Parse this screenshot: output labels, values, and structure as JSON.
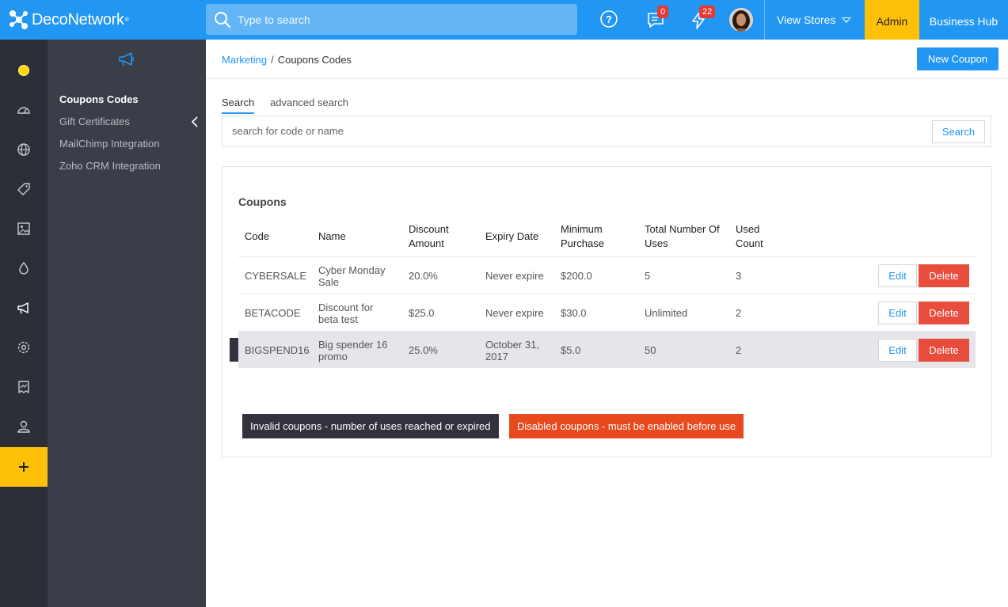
{
  "topbar": {
    "brand": "DecoNetwork",
    "brand_mark": "®",
    "search_placeholder": "Type to search",
    "messages_count": "0",
    "notifications_count": "22",
    "view_stores": "View Stores",
    "admin": "Admin",
    "business_hub": "Business Hub"
  },
  "rail": {
    "icons": [
      "status-dot-icon",
      "dashboard-icon",
      "globe-icon",
      "tag-icon",
      "image-icon",
      "drop-icon",
      "megaphone-icon",
      "settings-icon",
      "report-icon",
      "user-icon"
    ],
    "plus": "+"
  },
  "subnav": {
    "items": [
      {
        "label": "Coupons Codes",
        "active": true
      },
      {
        "label": "Gift Certificates"
      },
      {
        "label": "MailChimp Integration"
      },
      {
        "label": "Zoho CRM Integration"
      }
    ]
  },
  "breadcrumb": {
    "parent": "Marketing",
    "separator": "/",
    "current": "Coupons Codes"
  },
  "actions": {
    "new_coupon": "New Coupon"
  },
  "tabs": [
    {
      "label": "Search"
    },
    {
      "label": "advanced search"
    }
  ],
  "search": {
    "placeholder": "search for code or name",
    "button": "Search"
  },
  "coupons": {
    "title": "Coupons",
    "headers": {
      "code": "Code",
      "name": "Name",
      "discount": [
        "Discount",
        "Amount"
      ],
      "expiry": "Expiry Date",
      "min_purchase": [
        "Minimum",
        "Purchase"
      ],
      "total_uses": [
        "Total Number Of",
        "Uses"
      ],
      "used": [
        "Used",
        "Count"
      ]
    },
    "rows": [
      {
        "code": "CYBERSALE",
        "name": [
          "Cyber Monday",
          "Sale"
        ],
        "discount": "20.0%",
        "expiry": [
          "Never expire"
        ],
        "min": "$200.0",
        "total": "5",
        "used": "3",
        "edit": "Edit",
        "delete": "Delete"
      },
      {
        "code": "BETACODE",
        "name": [
          "Discount for",
          "beta test"
        ],
        "discount": "$25.0",
        "expiry": [
          "Never expire"
        ],
        "min": "$30.0",
        "total": "Unlimited",
        "used": "2",
        "edit": "Edit",
        "delete": "Delete"
      },
      {
        "code": "BIGSPEND16",
        "name": [
          "Big spender 16",
          "promo"
        ],
        "discount": "25.0%",
        "expiry": [
          "October 31,",
          "2017"
        ],
        "min": "$5.0",
        "total": "50",
        "used": "2",
        "edit": "Edit",
        "delete": "Delete"
      }
    ]
  },
  "legend": {
    "invalid": "Invalid coupons - number of uses reached or expired",
    "disabled": "Disabled coupons - must be enabled before use"
  },
  "colors": {
    "primary": "#2196f3",
    "accent": "#ffc107",
    "danger": "#e74c3c",
    "invalid": "#34303e",
    "disabled": "#e8491d"
  }
}
